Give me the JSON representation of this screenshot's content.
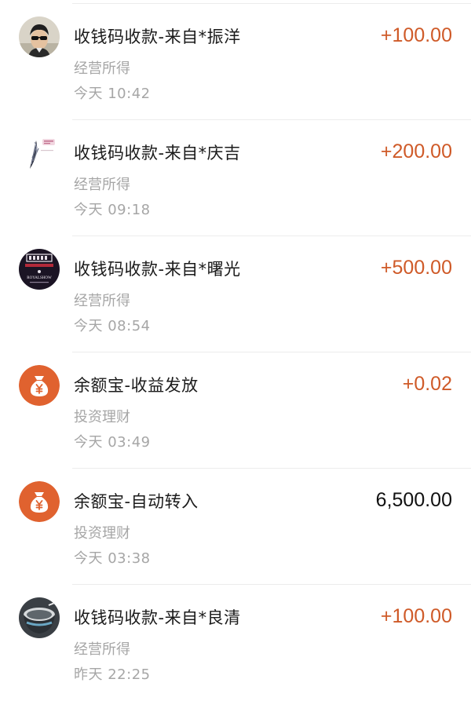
{
  "colors": {
    "income": "#cf5a28",
    "neutral": "#111111",
    "yuebao_icon_bg": "#e0622f"
  },
  "transactions": [
    {
      "avatar": "person-avatar-sunglasses",
      "title": "收钱码收款-来自*振洋",
      "category": "经营所得",
      "time": "今天  10:42",
      "amount": "+100.00",
      "amount_type": "income"
    },
    {
      "avatar": "feather-logo-avatar",
      "title": "收钱码收款-来自*庆吉",
      "category": "经营所得",
      "time": "今天  09:18",
      "amount": "+200.00",
      "amount_type": "income"
    },
    {
      "avatar": "royalshow-logo-avatar",
      "avatar_text": "ROYALSHOW",
      "title": "收钱码收款-来自*曙光",
      "category": "经营所得",
      "time": "今天  08:54",
      "amount": "+500.00",
      "amount_type": "income"
    },
    {
      "avatar": "money-bag-icon",
      "title": "余额宝-收益发放",
      "category": "投资理财",
      "time": "今天  03:49",
      "amount": "+0.02",
      "amount_type": "income"
    },
    {
      "avatar": "money-bag-icon",
      "title": "余额宝-自动转入",
      "category": "投资理财",
      "time": "今天  03:38",
      "amount": "6,500.00",
      "amount_type": "neutral"
    },
    {
      "avatar": "cup-photo-avatar",
      "title": "收钱码收款-来自*良清",
      "category": "经营所得",
      "time": "昨天  22:25",
      "amount": "+100.00",
      "amount_type": "income"
    }
  ]
}
